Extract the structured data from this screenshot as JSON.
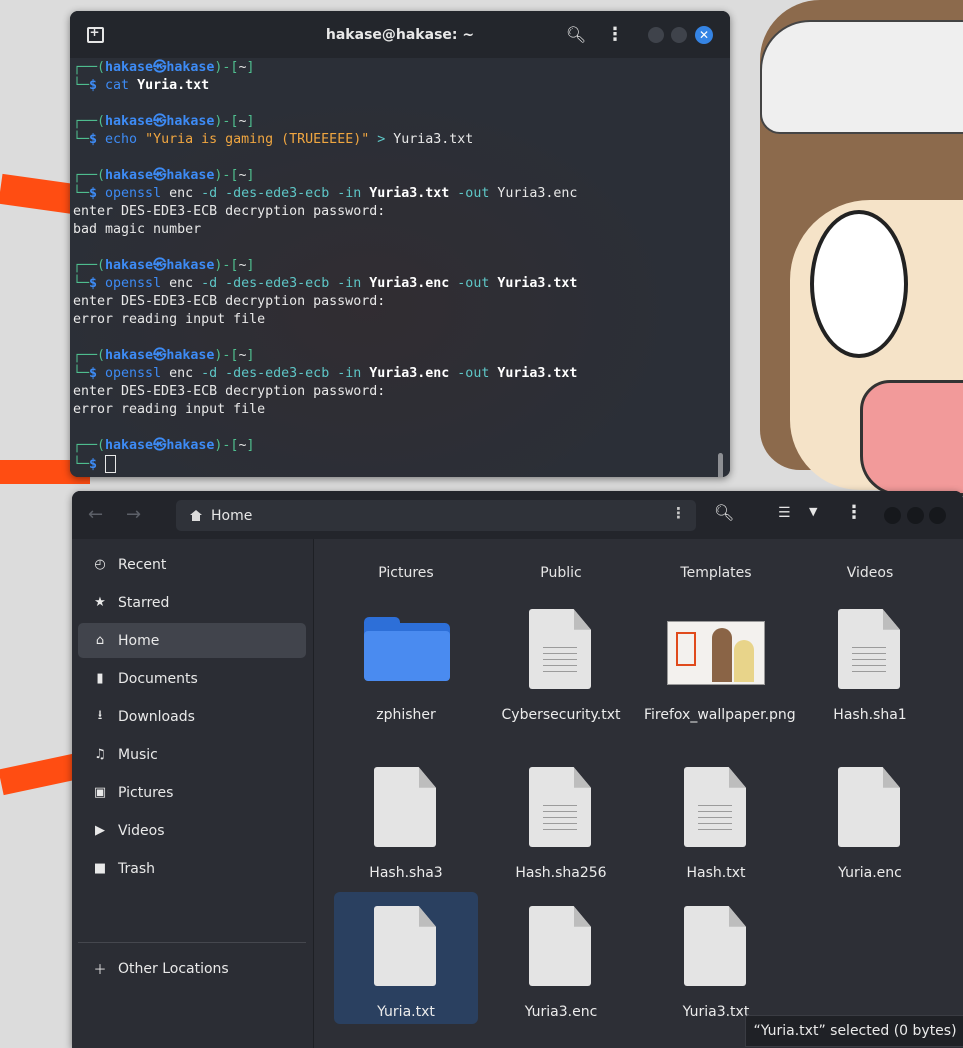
{
  "terminal": {
    "title": "hakase@hakase: ~",
    "prompt": {
      "user": "hakase",
      "at": "㉿",
      "host": "hakase",
      "dir": "~"
    },
    "blocks": [
      {
        "cmd": "cat",
        "args": [
          {
            "t": "Yuria.txt",
            "s": "bright"
          }
        ],
        "output": []
      },
      {
        "cmd": "echo",
        "args": [
          {
            "t": "\"Yuria is gaming (TRUEEEEE)\"",
            "s": "str"
          },
          {
            "t": " > ",
            "s": "opt"
          },
          {
            "t": "Yuria3.txt",
            "s": "wht"
          }
        ],
        "output": []
      },
      {
        "cmd": "openssl",
        "args": [
          {
            "t": "enc ",
            "s": "wht"
          },
          {
            "t": "-d -des-ede3-ecb -in ",
            "s": "opt"
          },
          {
            "t": "Yuria3.txt",
            "s": "bright"
          },
          {
            "t": " -out ",
            "s": "opt"
          },
          {
            "t": "Yuria3.enc",
            "s": "wht"
          }
        ],
        "output": [
          "enter DES-EDE3-ECB decryption password:",
          "bad magic number"
        ]
      },
      {
        "cmd": "openssl",
        "args": [
          {
            "t": "enc ",
            "s": "wht"
          },
          {
            "t": "-d -des-ede3-ecb -in ",
            "s": "opt"
          },
          {
            "t": "Yuria3.enc",
            "s": "bright"
          },
          {
            "t": " -out ",
            "s": "opt"
          },
          {
            "t": "Yuria3.txt",
            "s": "bright"
          }
        ],
        "output": [
          "enter DES-EDE3-ECB decryption password:",
          "error reading input file"
        ]
      },
      {
        "cmd": "openssl",
        "args": [
          {
            "t": "enc ",
            "s": "wht"
          },
          {
            "t": "-d -des-ede3-ecb -in ",
            "s": "opt"
          },
          {
            "t": "Yuria3.enc",
            "s": "bright"
          },
          {
            "t": " -out ",
            "s": "opt"
          },
          {
            "t": "Yuria3.txt",
            "s": "bright"
          }
        ],
        "output": [
          "enter DES-EDE3-ECB decryption password:",
          "error reading input file"
        ]
      }
    ]
  },
  "files": {
    "path": "Home",
    "sidebar": [
      {
        "label": "Recent",
        "icon": "clock-icon"
      },
      {
        "label": "Starred",
        "icon": "star-icon"
      },
      {
        "label": "Home",
        "icon": "home-icon",
        "active": true
      },
      {
        "label": "Documents",
        "icon": "document-icon"
      },
      {
        "label": "Downloads",
        "icon": "download-icon"
      },
      {
        "label": "Music",
        "icon": "music-icon"
      },
      {
        "label": "Pictures",
        "icon": "picture-icon"
      },
      {
        "label": "Videos",
        "icon": "video-icon"
      },
      {
        "label": "Trash",
        "icon": "trash-icon"
      }
    ],
    "other_locations": "Other Locations",
    "top_row": [
      "Pictures",
      "Public",
      "Templates",
      "Videos"
    ],
    "items": [
      {
        "name": "zphisher",
        "type": "folder"
      },
      {
        "name": "Cybersecurity.txt",
        "type": "text"
      },
      {
        "name": "Firefox_wallpaper.png",
        "type": "image"
      },
      {
        "name": "Hash.sha1",
        "type": "text"
      },
      {
        "name": "Hash.sha3",
        "type": "blank"
      },
      {
        "name": "Hash.sha256",
        "type": "text"
      },
      {
        "name": "Hash.txt",
        "type": "text"
      },
      {
        "name": "Yuria.enc",
        "type": "blank"
      },
      {
        "name": "Yuria.txt",
        "type": "blank",
        "selected": true
      },
      {
        "name": "Yuria3.enc",
        "type": "blank"
      },
      {
        "name": "Yuria3.txt",
        "type": "blank"
      }
    ],
    "status": "“Yuria.txt” selected  (0 bytes)"
  },
  "colors": {
    "accent": "#3584e4",
    "folder": "#4a8bf0",
    "selection": "#2a4060"
  }
}
